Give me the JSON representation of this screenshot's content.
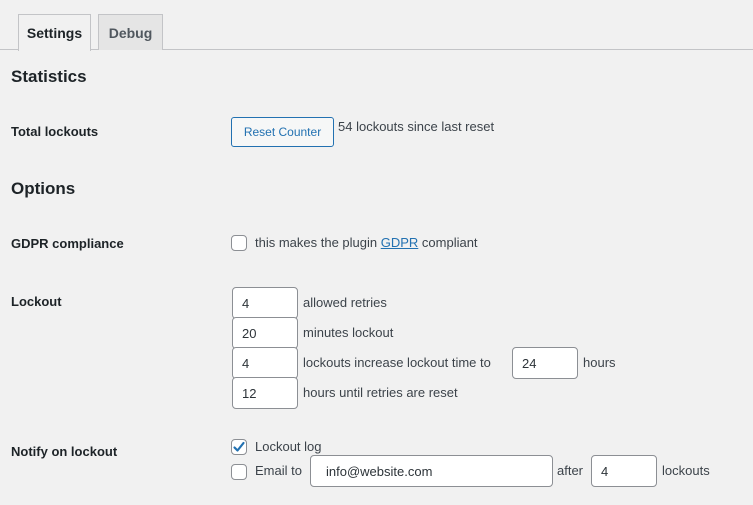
{
  "tabs": [
    {
      "label": "Settings",
      "active": true
    },
    {
      "label": "Debug",
      "active": false
    }
  ],
  "statistics": {
    "heading": "Statistics",
    "total_lockouts_label": "Total lockouts",
    "reset_button": "Reset Counter",
    "lockouts_text": "54 lockouts since last reset"
  },
  "options": {
    "heading": "Options",
    "gdpr": {
      "label": "GDPR compliance",
      "checked": false,
      "text_before": "this makes the plugin ",
      "link_text": "GDPR",
      "text_after": " compliant"
    },
    "lockout": {
      "label": "Lockout",
      "allowed_retries": {
        "value": "4",
        "suffix": "allowed retries"
      },
      "minutes_lockout": {
        "value": "20",
        "suffix": "minutes lockout"
      },
      "lockouts_increase": {
        "value": "4",
        "middle": "lockouts increase lockout time to",
        "hours_value": "24",
        "suffix": "hours"
      },
      "valid_duration": {
        "value": "12",
        "suffix": "hours until retries are reset"
      }
    },
    "notify": {
      "label": "Notify on lockout",
      "lockout_log": {
        "label": "Lockout log",
        "checked": true
      },
      "email": {
        "label": "Email to",
        "checked": false,
        "value": "info@website.com",
        "after_label": "after",
        "after_value": "4",
        "suffix": "lockouts"
      }
    }
  },
  "colors": {
    "accent": "#2271b1",
    "background": "#f1f1f1"
  }
}
